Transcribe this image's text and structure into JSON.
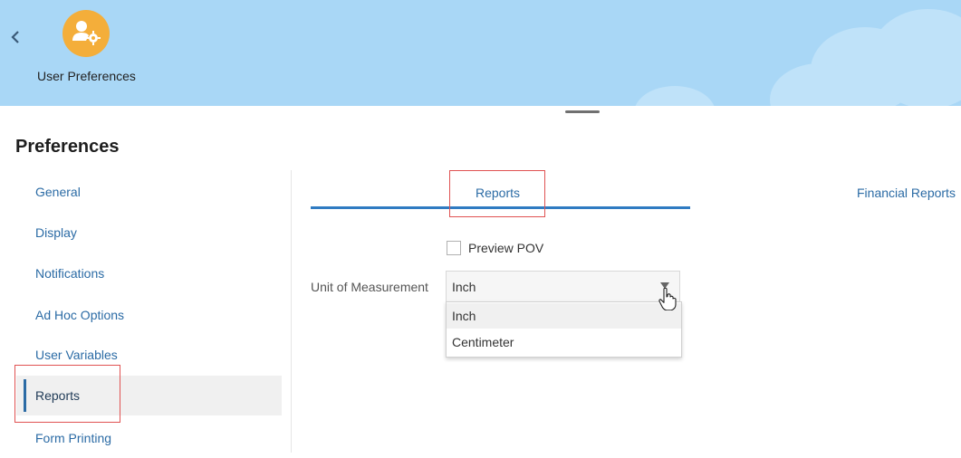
{
  "header": {
    "app_title": "User Preferences",
    "back_icon": "chevron-left-icon",
    "app_icon": "user-gear-icon",
    "banner_color": "#a9d7f6",
    "app_icon_color": "#f4ae3a"
  },
  "page": {
    "title": "Preferences"
  },
  "sidebar": {
    "items": [
      {
        "label": "General"
      },
      {
        "label": "Display"
      },
      {
        "label": "Notifications"
      },
      {
        "label": "Ad Hoc Options"
      },
      {
        "label": "User Variables"
      },
      {
        "label": "Reports",
        "selected": true
      },
      {
        "label": "Form Printing"
      }
    ]
  },
  "tabs": [
    {
      "label": "Reports",
      "selected": true
    },
    {
      "label": "Financial Reports",
      "selected": false
    }
  ],
  "reports": {
    "preview_pov": {
      "label": "Preview POV",
      "checked": false
    },
    "unit_of_measurement": {
      "label": "Unit of Measurement",
      "value": "Inch",
      "options": [
        "Inch",
        "Centimeter"
      ],
      "dropdown_open": true
    }
  },
  "colors": {
    "accent": "#2b6ba5",
    "tab_underline": "#2f7bc2",
    "highlight_box": "#e05252"
  }
}
